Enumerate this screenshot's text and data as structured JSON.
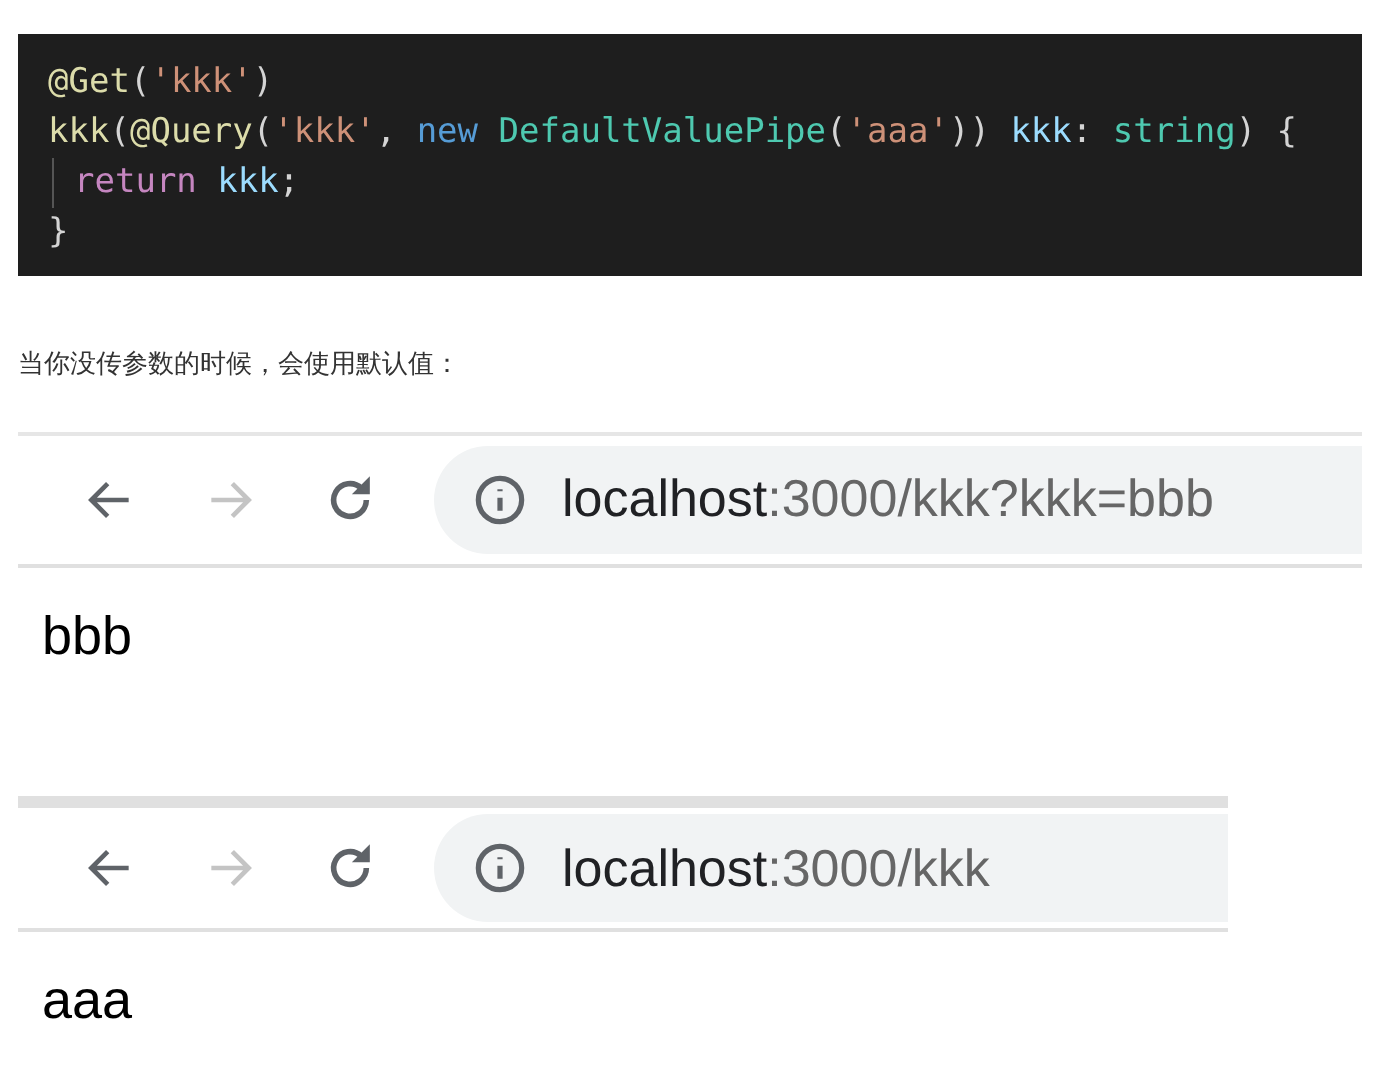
{
  "code_block": {
    "lines": [
      {
        "indent": false,
        "tokens": [
          {
            "text": "@Get",
            "kind": "func"
          },
          {
            "text": "(",
            "kind": "punct"
          },
          {
            "text": "'kkk'",
            "kind": "string"
          },
          {
            "text": ")",
            "kind": "punct"
          }
        ]
      },
      {
        "indent": false,
        "tokens": [
          {
            "text": "kkk",
            "kind": "func"
          },
          {
            "text": "(",
            "kind": "punct"
          },
          {
            "text": "@Query",
            "kind": "func"
          },
          {
            "text": "(",
            "kind": "punct"
          },
          {
            "text": "'kkk'",
            "kind": "string"
          },
          {
            "text": ", ",
            "kind": "punct"
          },
          {
            "text": "new ",
            "kind": "keyword"
          },
          {
            "text": "DefaultValuePipe",
            "kind": "type"
          },
          {
            "text": "(",
            "kind": "punct"
          },
          {
            "text": "'aaa'",
            "kind": "string"
          },
          {
            "text": ")) ",
            "kind": "punct"
          },
          {
            "text": "kkk",
            "kind": "variable"
          },
          {
            "text": ": ",
            "kind": "punct"
          },
          {
            "text": "string",
            "kind": "type"
          },
          {
            "text": ") {",
            "kind": "punct"
          }
        ]
      },
      {
        "indent": true,
        "tokens": [
          {
            "text": "return ",
            "kind": "control"
          },
          {
            "text": "kkk",
            "kind": "variable"
          },
          {
            "text": ";",
            "kind": "punct"
          }
        ]
      },
      {
        "indent": false,
        "tokens": [
          {
            "text": "}",
            "kind": "punct"
          }
        ]
      }
    ]
  },
  "paragraph": "当你没传参数的时候，会使用默认值：",
  "browsers": [
    {
      "url_host": "localhost",
      "url_rest": ":3000/kkk?kkk=bbb",
      "forward_disabled": true,
      "content": "bbb"
    },
    {
      "url_host": "localhost",
      "url_rest": ":3000/kkk",
      "forward_disabled": true,
      "content": "aaa"
    }
  ]
}
